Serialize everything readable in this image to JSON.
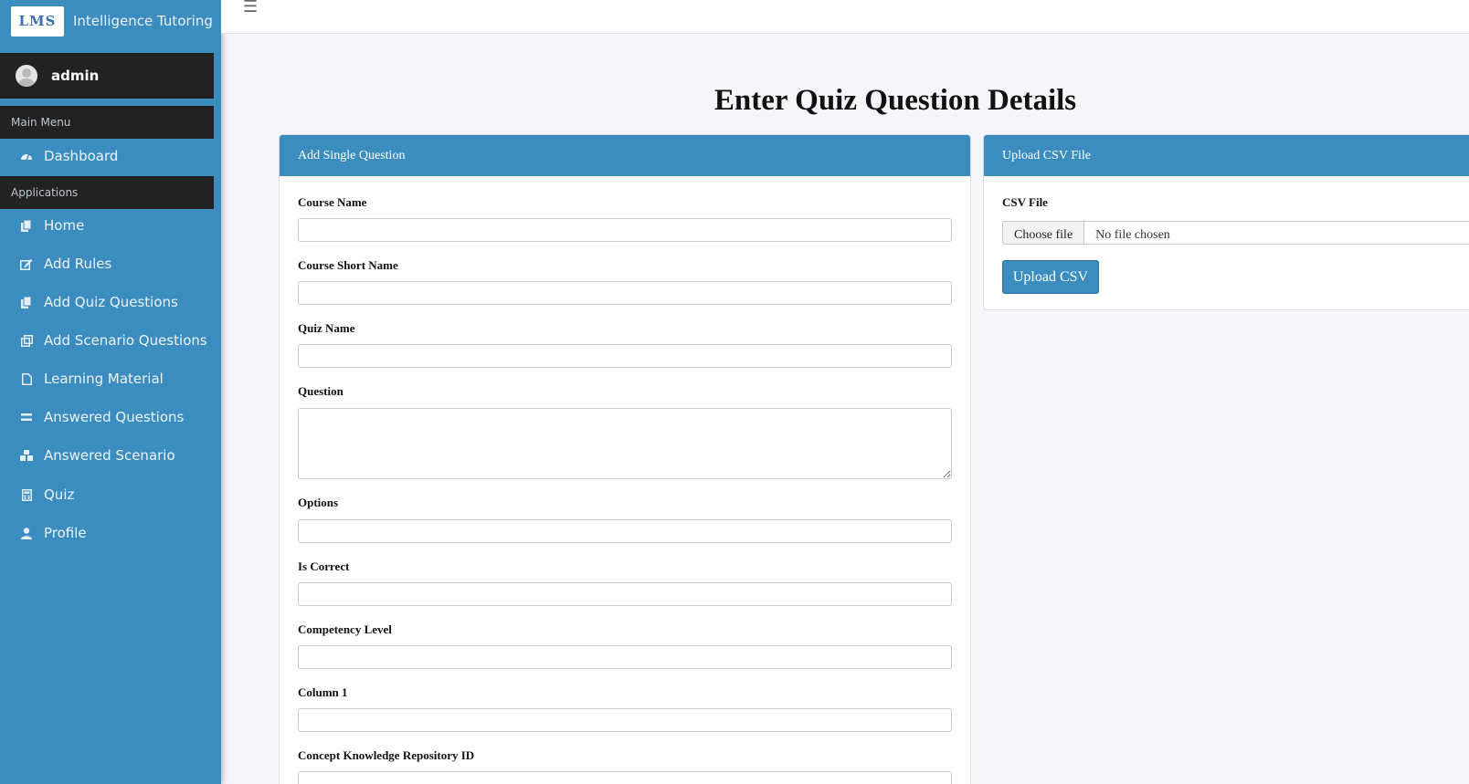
{
  "brand": {
    "logo_text": "LMS",
    "name": "Intelligence Tutoring"
  },
  "user": {
    "name": "admin"
  },
  "sidebar": {
    "main_menu_header": "Main Menu",
    "applications_header": "Applications",
    "items": [
      {
        "label": "Dashboard",
        "icon": "dashboard-icon"
      },
      {
        "label": "Home",
        "icon": "copy-icon"
      },
      {
        "label": "Add Rules",
        "icon": "edit-icon"
      },
      {
        "label": "Add Quiz Questions",
        "icon": "copy-icon"
      },
      {
        "label": "Add Scenario Questions",
        "icon": "clone-icon"
      },
      {
        "label": "Learning Material",
        "icon": "file-icon"
      },
      {
        "label": "Answered Questions",
        "icon": "equals-icon"
      },
      {
        "label": "Answered Scenario",
        "icon": "cubes-icon"
      },
      {
        "label": "Quiz",
        "icon": "calculator-icon"
      },
      {
        "label": "Profile",
        "icon": "user-icon"
      }
    ]
  },
  "page": {
    "title": "Enter Quiz Question Details"
  },
  "single_question": {
    "header": "Add Single Question",
    "fields": [
      {
        "label": "Course Name",
        "value": ""
      },
      {
        "label": "Course Short Name",
        "value": ""
      },
      {
        "label": "Quiz Name",
        "value": ""
      },
      {
        "label": "Question",
        "value": ""
      },
      {
        "label": "Options",
        "value": ""
      },
      {
        "label": "Is Correct",
        "value": ""
      },
      {
        "label": "Competency Level",
        "value": ""
      },
      {
        "label": "Column 1",
        "value": ""
      },
      {
        "label": "Concept Knowledge Repository ID",
        "value": ""
      }
    ]
  },
  "csv_upload": {
    "header": "Upload CSV File",
    "label": "CSV File",
    "choose_button": "Choose file",
    "file_status": "No file chosen",
    "upload_button": "Upload CSV"
  },
  "colors": {
    "sidebar": "#3c8dbf",
    "dark_panel": "#222222",
    "primary": "#3c8dbf"
  }
}
